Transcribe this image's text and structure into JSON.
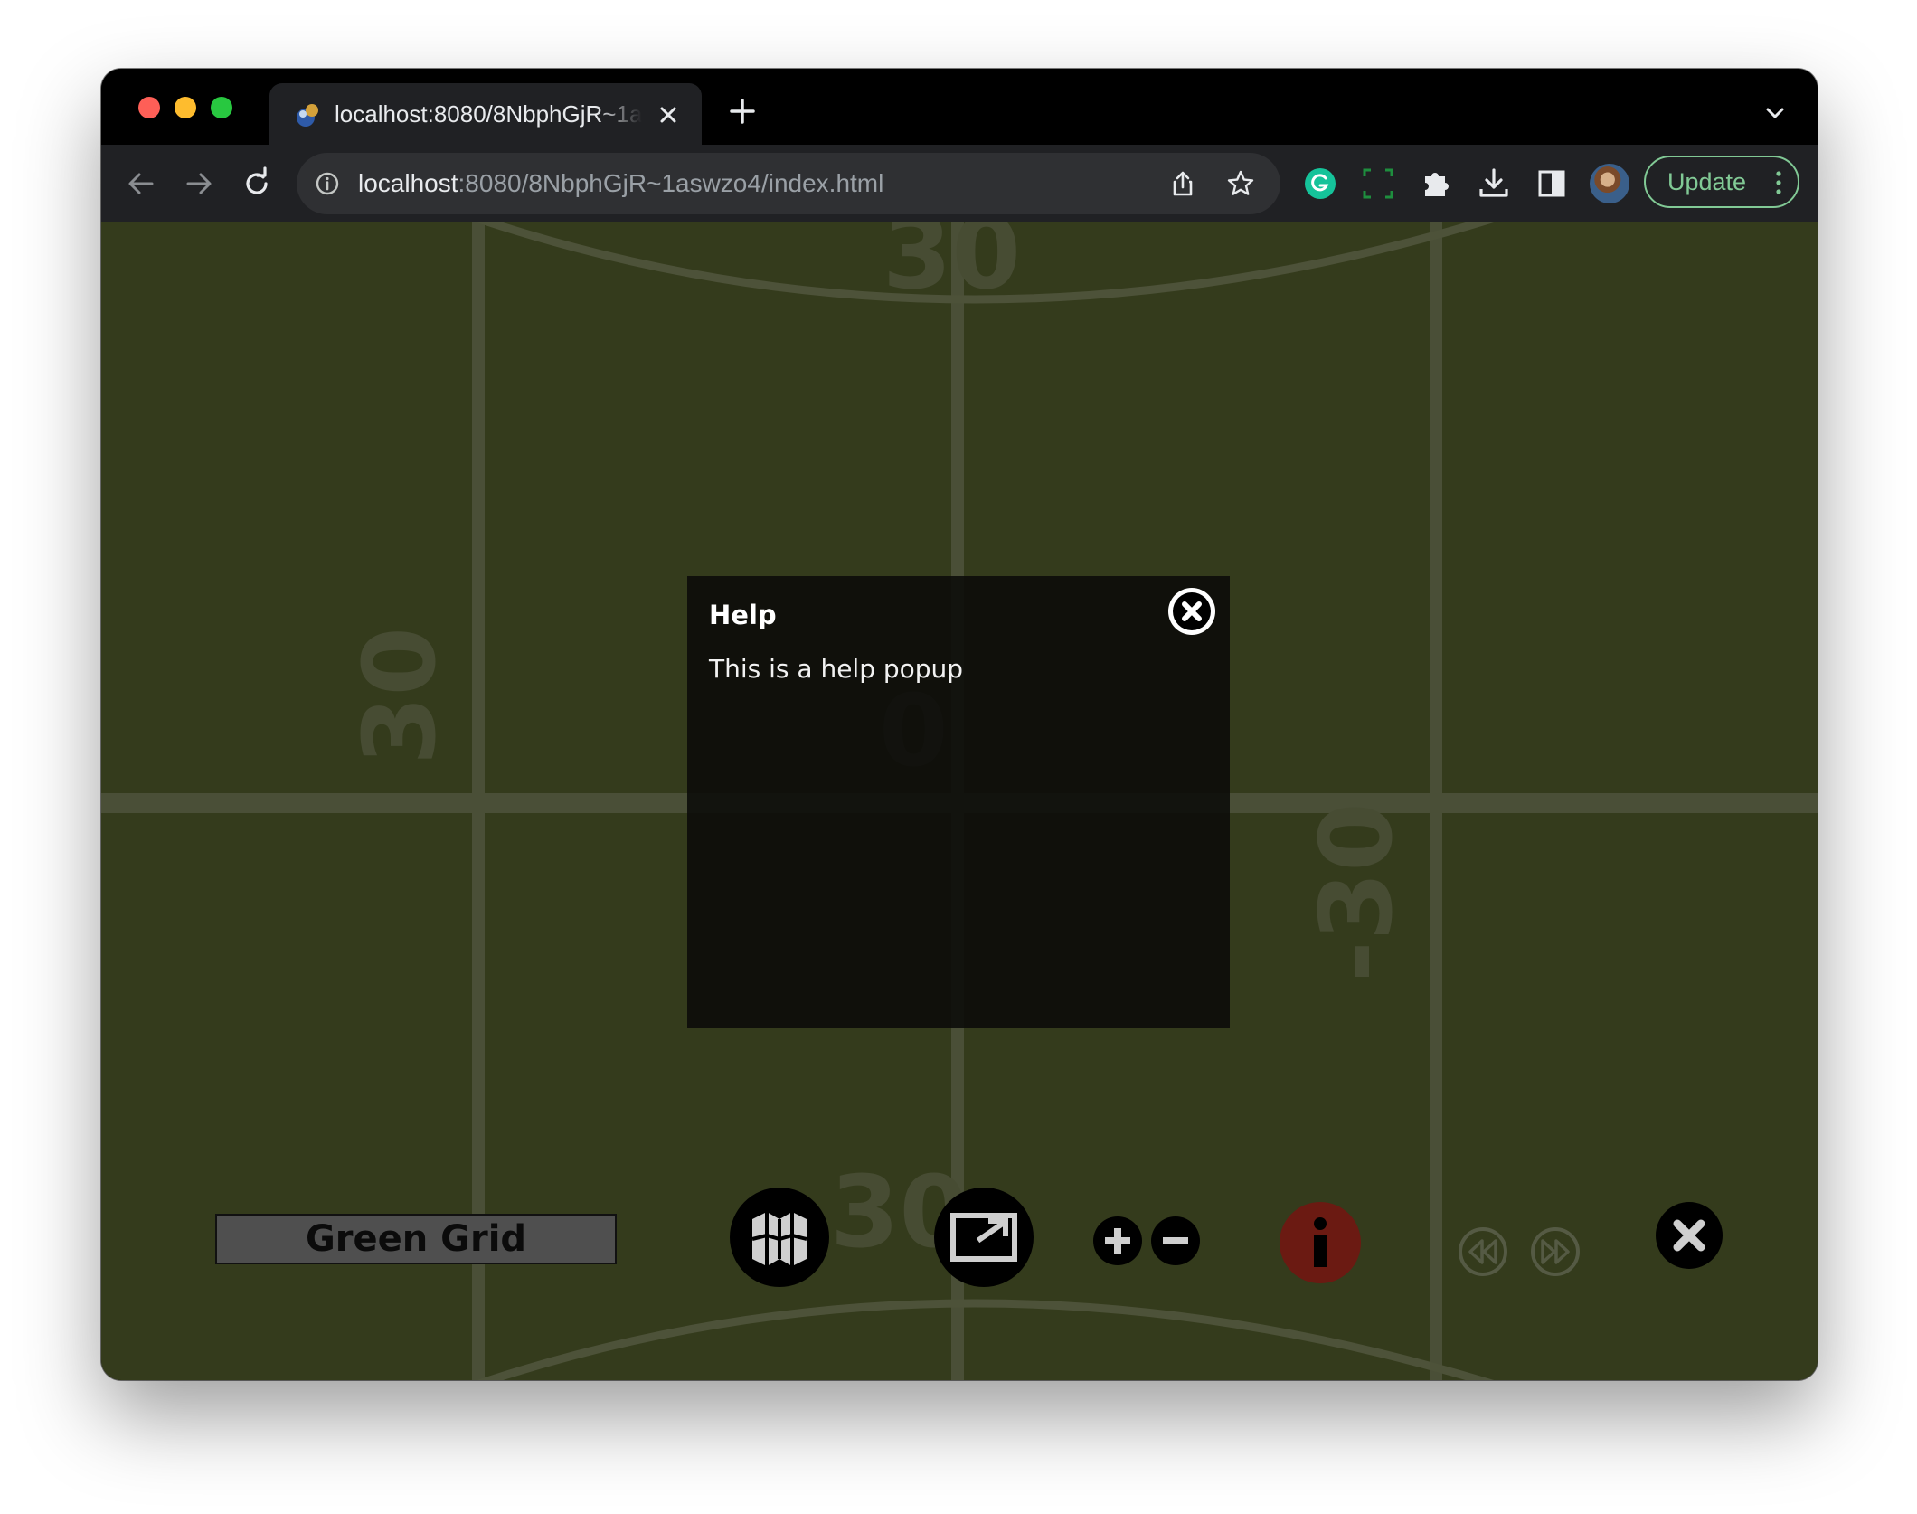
{
  "browser": {
    "tab_title": "localhost:8080/8NbphGjR~1aswzo4/index.html",
    "url_host": "localhost",
    "url_rest": ":8080/8NbphGjR~1aswzo4/index.html",
    "update_label": "Update"
  },
  "grid": {
    "labels": {
      "top": "30",
      "left": "30",
      "center": "0",
      "right": "-30",
      "bottom": "30"
    }
  },
  "popup": {
    "title": "Help",
    "body": "This is a help popup"
  },
  "controls": {
    "title": "Green Grid",
    "buttons": [
      "map-icon",
      "fullscreen-icon",
      "zoom-in-icon",
      "zoom-out-icon",
      "info-icon",
      "rewind-icon",
      "fast-forward-icon",
      "close-icon"
    ]
  },
  "colors": {
    "background": "#343b1c",
    "grid_line": "#4a4f37",
    "info_button": "#6b1a12",
    "update_accent": "#81c995"
  }
}
